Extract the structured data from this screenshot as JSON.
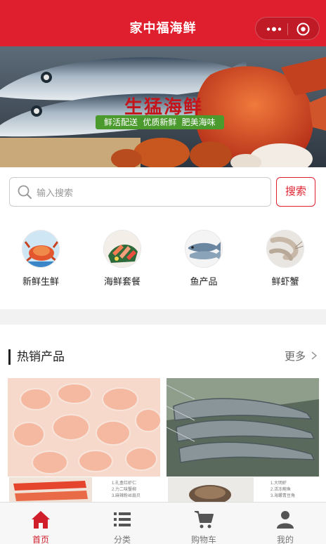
{
  "header": {
    "title": "家中福海鲜"
  },
  "banner": {
    "headline": "生猛海鲜",
    "slogan": "鲜活配送 优质新鲜 肥美海味"
  },
  "search": {
    "placeholder": "输入搜索",
    "button_label": "搜索"
  },
  "categories": [
    {
      "label": "新鲜生鲜",
      "icon": "crab-icon"
    },
    {
      "label": "海鲜套餐",
      "icon": "sashimi-platter-icon"
    },
    {
      "label": "鱼产品",
      "icon": "fish-icon"
    },
    {
      "label": "鲜虾蟹",
      "icon": "shrimp-icon"
    }
  ],
  "hot": {
    "title": "热销产品",
    "more": "更多"
  },
  "products": [
    {
      "notes": [
        "1.礼盒红虾仁",
        "2.力二味蟹柳",
        "3.麻辣粉丝扇贝"
      ]
    },
    {
      "notes": [
        "1.大明虾",
        "2.活冻鲍鱼",
        "3.海螺青豆角"
      ]
    }
  ],
  "tabs": [
    {
      "label": "首页",
      "icon": "home-icon",
      "active": true
    },
    {
      "label": "分类",
      "icon": "list-icon",
      "active": false
    },
    {
      "label": "购物车",
      "icon": "cart-icon",
      "active": false
    },
    {
      "label": "我的",
      "icon": "user-icon",
      "active": false
    }
  ],
  "colors": {
    "brand": "#e01f2e",
    "tab_active": "#d01e2b",
    "tab_inactive": "#777777"
  }
}
